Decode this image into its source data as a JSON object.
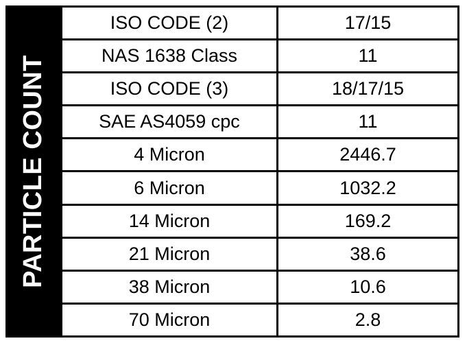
{
  "table": {
    "vertical_header": "PARTICLE COUNT",
    "accent_color": "#000000",
    "background_color": "#FFFFFF",
    "rows": [
      {
        "label": "ISO CODE (2)",
        "value": "17/15"
      },
      {
        "label": "NAS 1638 Class",
        "value": "11"
      },
      {
        "label": "ISO CODE (3)",
        "value": "18/17/15"
      },
      {
        "label": "SAE AS4059 cpc",
        "value": "11"
      },
      {
        "label": "4 Micron",
        "value": "2446.7"
      },
      {
        "label": "6 Micron",
        "value": "1032.2"
      },
      {
        "label": "14 Micron",
        "value": "169.2"
      },
      {
        "label": "21 Micron",
        "value": "38.6"
      },
      {
        "label": "38 Micron",
        "value": "10.6"
      },
      {
        "label": "70 Micron",
        "value": "2.8"
      }
    ]
  }
}
